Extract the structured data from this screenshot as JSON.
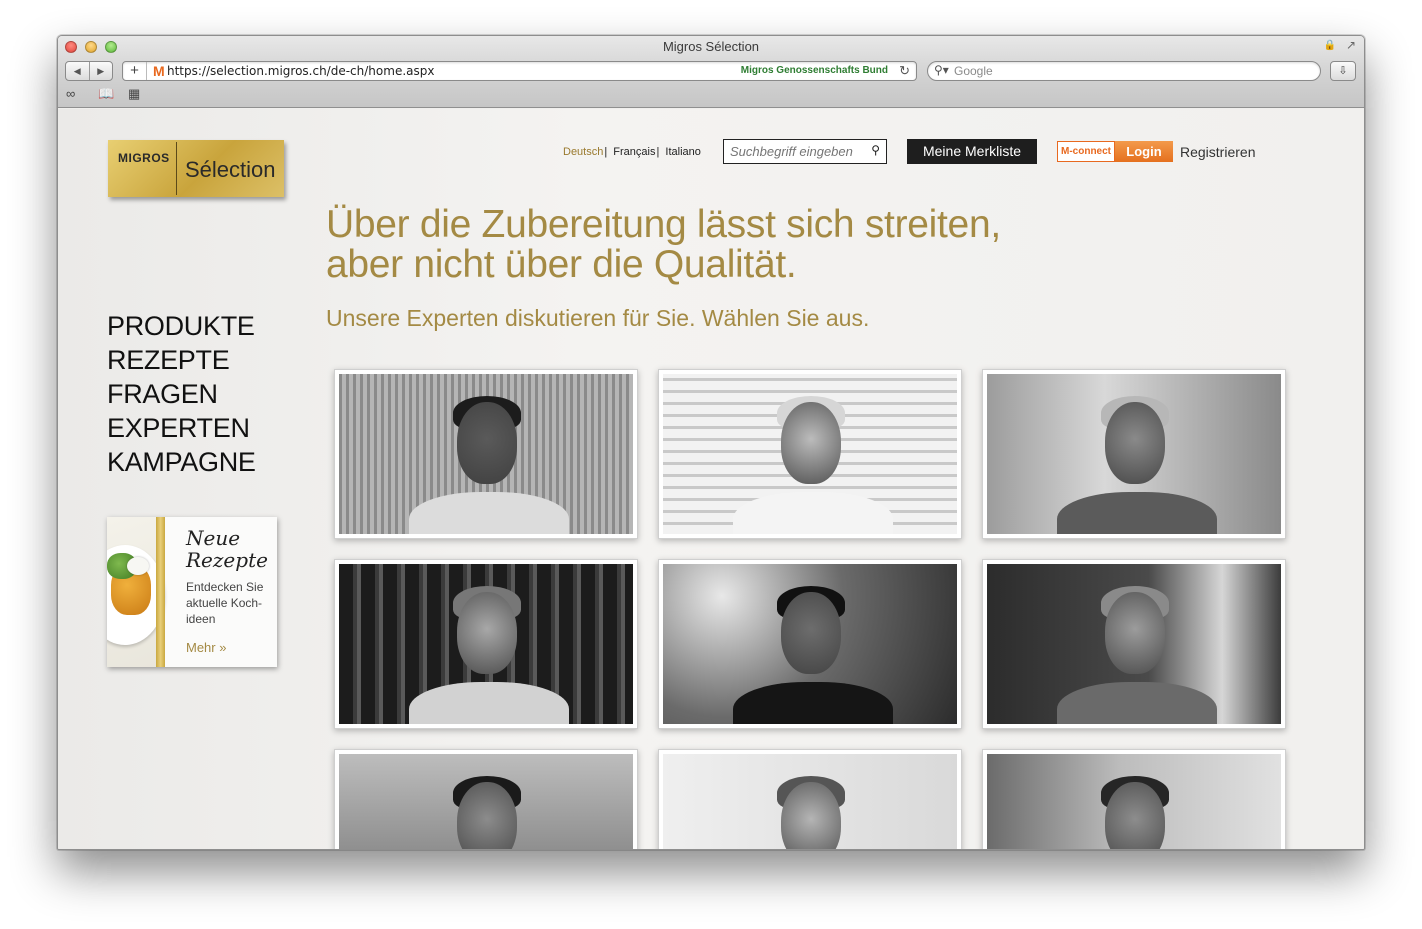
{
  "browser": {
    "window_title": "Migros Sélection",
    "url": "https://selection.migros.ch/de-ch/home.aspx",
    "site_owner": "Migros Genossenschafts Bund",
    "search_placeholder": "Google",
    "url_prefix_icon": "M"
  },
  "header": {
    "logo_migros": "MIGROS",
    "logo_selection": "Sélection",
    "languages": [
      "Deutsch",
      "Français",
      "Italiano"
    ],
    "active_language": "Deutsch",
    "search_placeholder": "Suchbegriff eingeben",
    "merkliste_label": "Meine Merkliste",
    "mconnect_label": "M-connect",
    "login_label": "Login",
    "register_label": "Registrieren"
  },
  "hero": {
    "headline_line1": "Über die Zubereitung lässt sich streiten,",
    "headline_line2": "aber nicht über die Qualität.",
    "subheadline": "Unsere Experten diskutieren für Sie. Wählen Sie aus."
  },
  "nav": {
    "items": [
      "PRODUKTE",
      "REZEPTE",
      "FRAGEN",
      "EXPERTEN",
      "KAMPAGNE"
    ]
  },
  "teaser": {
    "title_line1": "Neue",
    "title_line2": "Rezepte",
    "text": "Entdecken Sie aktuelle Koch-ideen",
    "more_label": "Mehr »"
  },
  "experts": {
    "tiles": [
      {
        "name": "expert-tile-1"
      },
      {
        "name": "expert-tile-2"
      },
      {
        "name": "expert-tile-3"
      },
      {
        "name": "expert-tile-4"
      },
      {
        "name": "expert-tile-5"
      },
      {
        "name": "expert-tile-6"
      },
      {
        "name": "expert-tile-7"
      },
      {
        "name": "expert-tile-8"
      },
      {
        "name": "expert-tile-9"
      }
    ]
  },
  "colors": {
    "accent_gold": "#a48a44",
    "mconnect_orange": "#e8691f",
    "dark_button": "#1e1e1e"
  }
}
